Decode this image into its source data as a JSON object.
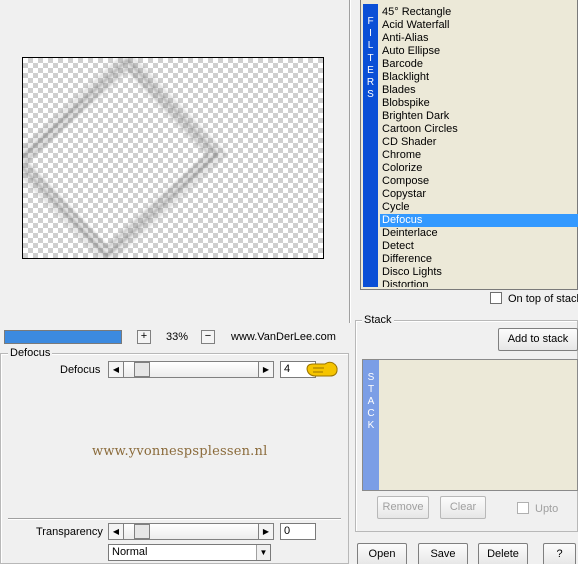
{
  "preview": {
    "zoom_percent": 33,
    "progress_fraction": 1.0
  },
  "zoom": {
    "plus_label": "+",
    "value": "33%",
    "minus_label": "−",
    "site": "www.VanDerLee.com"
  },
  "defocus": {
    "group_title": "Defocus",
    "label": "Defocus",
    "value": "4",
    "slider_fraction": 0.02,
    "hand_icon": "pointing-hand-icon"
  },
  "watermark": "www.yvonnespsplessen.nl",
  "transparency": {
    "label": "Transparency",
    "value": "0",
    "slider_fraction": 0.02
  },
  "blend_mode": {
    "selected": "Normal"
  },
  "filters": {
    "strip_letters": [
      "F",
      "I",
      "L",
      "T",
      "E",
      "R",
      "S"
    ],
    "items": [
      "45° Rectangle",
      "Acid Waterfall",
      "Anti-Alias",
      "Auto Ellipse",
      "Barcode",
      "Blacklight",
      "Blades",
      "Blobspike",
      "Brighten Dark",
      "Cartoon Circles",
      "CD Shader",
      "Chrome",
      "Colorize",
      "Compose",
      "Copystar",
      "Cycle",
      "Defocus",
      "Deinterlace",
      "Detect",
      "Difference",
      "Disco Lights",
      "Distortion"
    ],
    "selected": "Defocus",
    "on_top_label": "On top of stack"
  },
  "stack": {
    "group_title": "Stack",
    "add_label": "Add to stack",
    "strip_letters": [
      "S",
      "T",
      "A",
      "C",
      "K"
    ],
    "remove_label": "Remove",
    "clear_label": "Clear",
    "upto_label": "Upto"
  },
  "footer": {
    "open_label": "Open",
    "save_label": "Save",
    "delete_label": "Delete",
    "help_label": "?"
  },
  "colors": {
    "accent": "#3399ff",
    "filter_strip": "#0a4fd6",
    "stack_strip": "#7b9ee6",
    "watermark": "#8a6a3a"
  }
}
